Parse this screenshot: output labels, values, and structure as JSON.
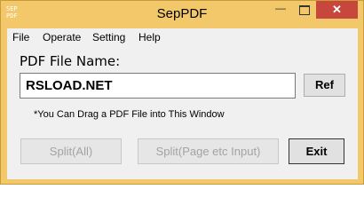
{
  "window": {
    "title": "SepPDF",
    "icon_text": [
      "SEP",
      "PDF"
    ],
    "controls": {
      "minimize": "—",
      "close": "✕"
    }
  },
  "menu": {
    "items": [
      "File",
      "Operate",
      "Setting",
      "Help"
    ]
  },
  "form": {
    "label": "PDF File Name:",
    "file_value": "RSLOAD.NET",
    "ref_label": "Ref",
    "hint": "*You Can Drag a PDF File into This Window"
  },
  "buttons": {
    "split_all": "Split(All)",
    "split_page": "Split(Page etc Input)",
    "exit": "Exit",
    "split_all_enabled": false,
    "split_page_enabled": false
  },
  "colors": {
    "title_bar": "#f2c86a",
    "close_button": "#c7473d",
    "client_bg": "#f0f0f0"
  }
}
